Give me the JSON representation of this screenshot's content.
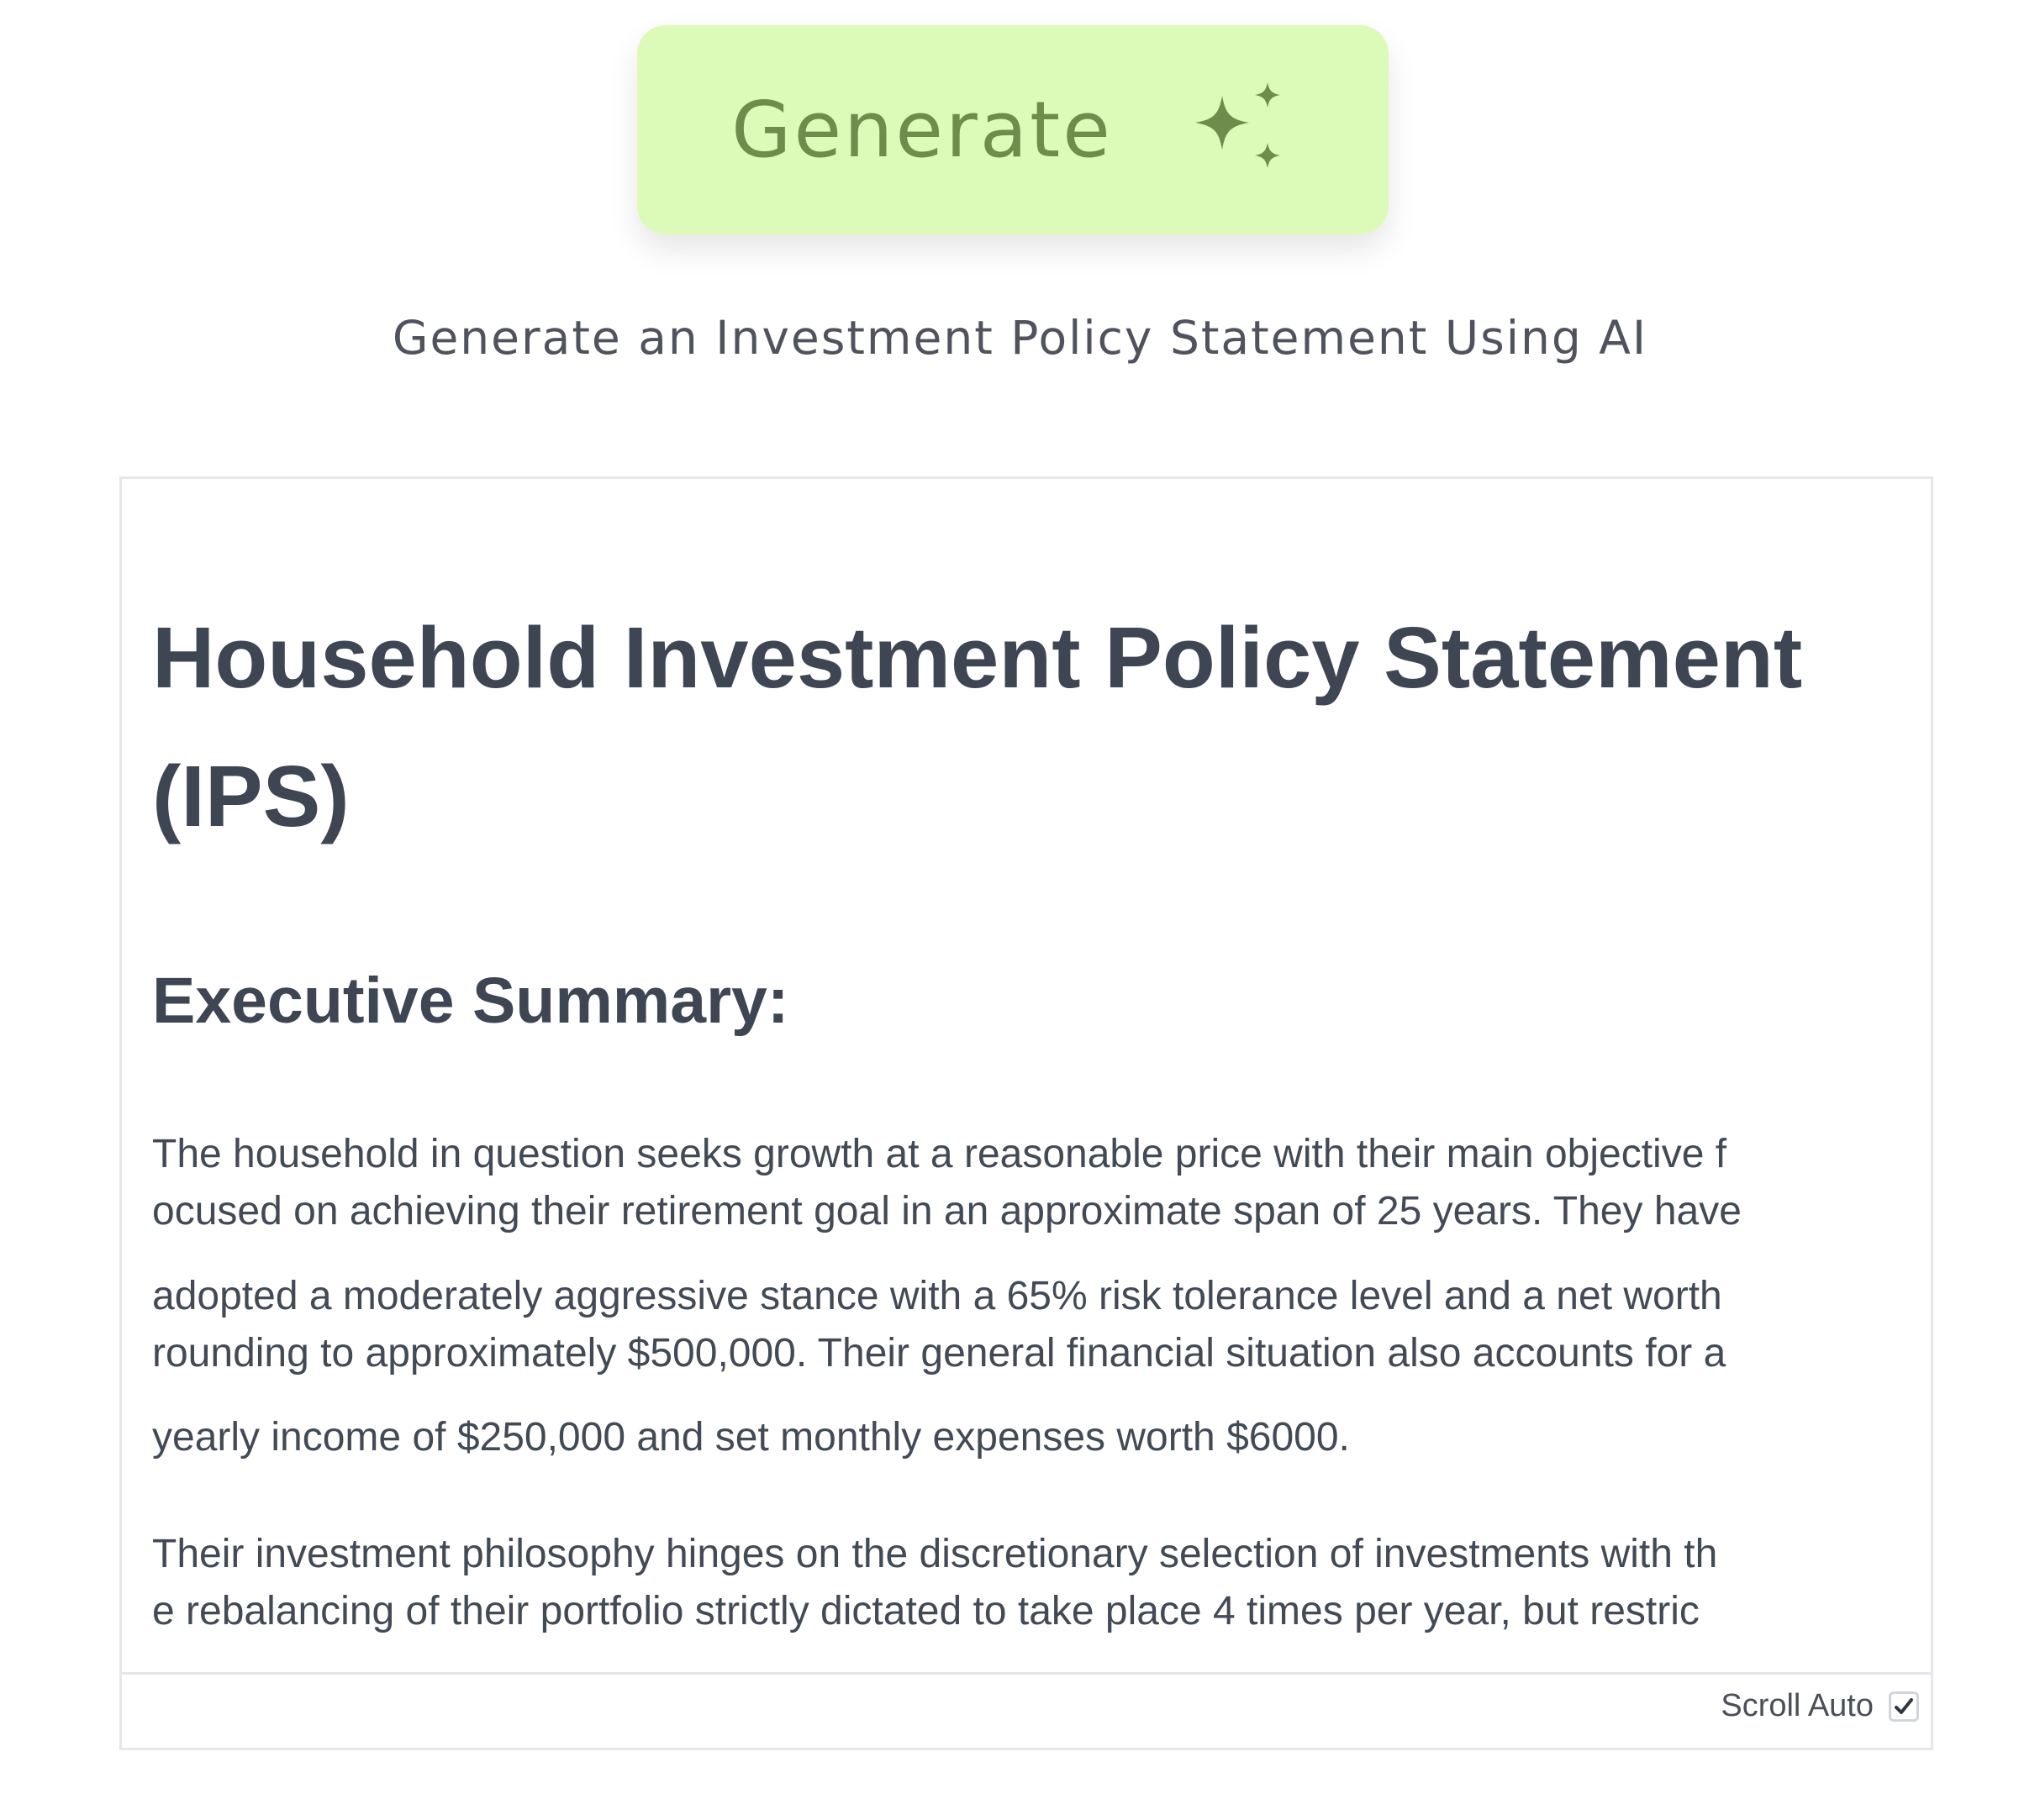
{
  "generate_button": {
    "label": "Generate",
    "icon": "sparkles-icon",
    "background_color": "#dcfbb8",
    "text_color": "#6e8d4c"
  },
  "subtitle": "Generate an Investment Policy Statement Using AI",
  "document": {
    "title": "Household Investment Policy Statement (IPS)",
    "section_heading": "Executive Summary:",
    "paragraphs": [
      {
        "lines": [
          "The household in question seeks growth at a reasonable price with their main objective f",
          "ocused on achieving their retirement goal in an approximate span of 25 years. They have"
        ]
      },
      {
        "lines": [
          "adopted a moderately aggressive stance with a 65% risk tolerance level and a net worth",
          "rounding to approximately $500,000. Their general financial situation also accounts for a"
        ]
      },
      {
        "lines": [
          "yearly income of $250,000 and set monthly expenses worth $6000."
        ]
      },
      {
        "lines": [
          "Their investment philosophy hinges on the discretionary selection of investments with th",
          "e rebalancing of their portfolio strictly dictated to take place 4 times per year, but restric"
        ]
      }
    ]
  },
  "footer": {
    "scroll_auto_label": "Scroll Auto",
    "scroll_auto_checked": true
  }
}
